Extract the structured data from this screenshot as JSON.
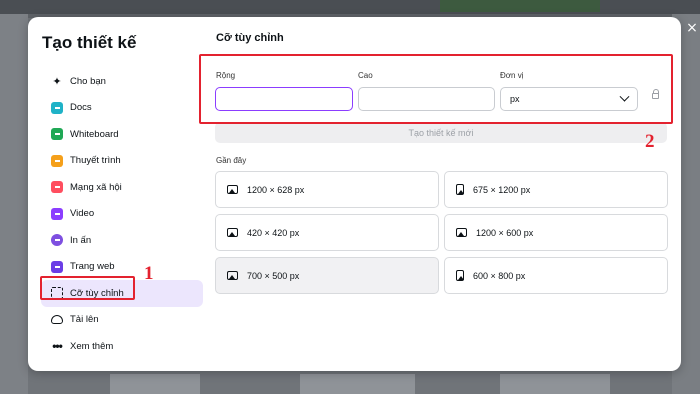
{
  "modal": {
    "title": "Tạo thiết kế",
    "close_glyph": "×"
  },
  "sidebar": {
    "items": [
      {
        "label": "Cho bạn",
        "icon": "sparkle-icon"
      },
      {
        "label": "Docs",
        "icon": "docs-icon"
      },
      {
        "label": "Whiteboard",
        "icon": "whiteboard-icon"
      },
      {
        "label": "Thuyết trình",
        "icon": "presentation-icon"
      },
      {
        "label": "Mạng xã hội",
        "icon": "social-icon"
      },
      {
        "label": "Video",
        "icon": "video-icon"
      },
      {
        "label": "In ấn",
        "icon": "print-icon"
      },
      {
        "label": "Trang web",
        "icon": "website-icon"
      },
      {
        "label": "Cỡ tùy chỉnh",
        "icon": "custom-size-icon",
        "active": true
      },
      {
        "label": "Tải lên",
        "icon": "upload-icon"
      },
      {
        "label": "Xem thêm",
        "icon": "more-icon"
      }
    ]
  },
  "annotations": {
    "marker1": "1",
    "marker2": "2",
    "highlight_color": "#e3222f"
  },
  "custom_size": {
    "title": "Cỡ tùy chỉnh",
    "width_label": "Rộng",
    "width_value": "",
    "height_label": "Cao",
    "height_value": "",
    "unit_label": "Đơn vị",
    "unit_value": "px",
    "create_button": "Tạo thiết kế mới"
  },
  "recent": {
    "label": "Gần đây",
    "items": [
      {
        "size": "1200 × 628 px",
        "orientation": "landscape"
      },
      {
        "size": "675 × 1200 px",
        "orientation": "portrait"
      },
      {
        "size": "420 × 420 px",
        "orientation": "landscape"
      },
      {
        "size": "1200 × 600 px",
        "orientation": "landscape"
      },
      {
        "size": "700 × 500 px",
        "orientation": "landscape"
      },
      {
        "size": "600 × 800 px",
        "orientation": "portrait"
      }
    ]
  },
  "colors": {
    "accent": "#8b3dff",
    "active_bg": "#ece6fd"
  }
}
